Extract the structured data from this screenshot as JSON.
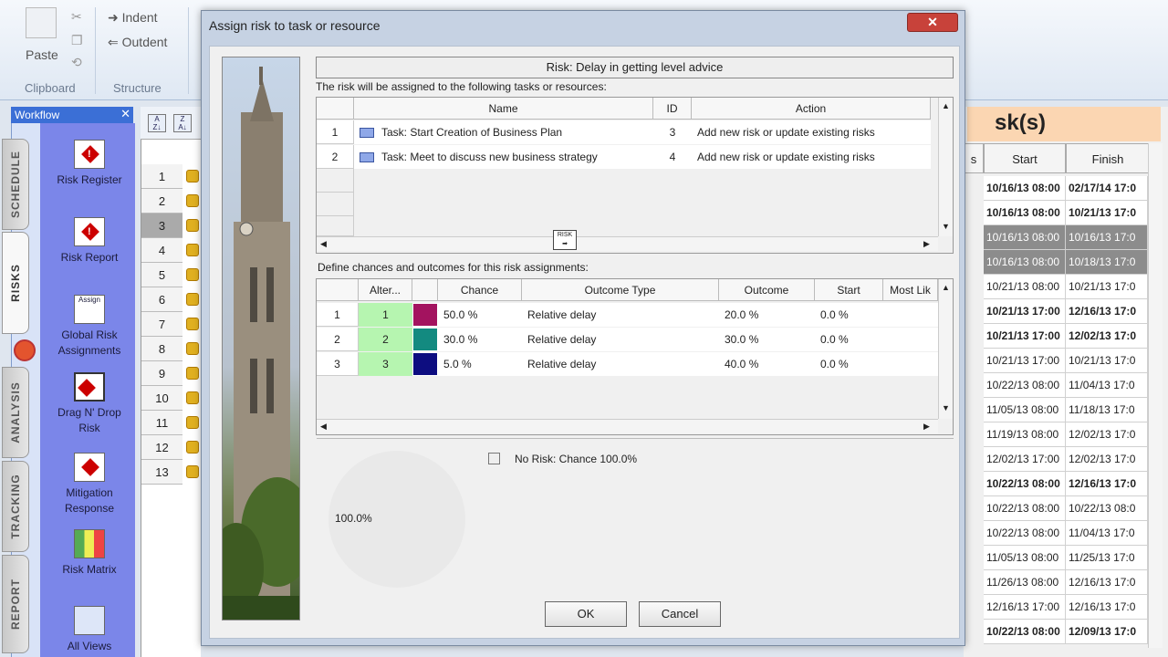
{
  "ribbon": {
    "paste_label": "Paste",
    "indent_label": "Indent",
    "outdent_label": "Outdent",
    "group_clipboard": "Clipboard",
    "group_structure": "Structure"
  },
  "workflow": {
    "title": "Workflow",
    "tabs": [
      "SCHEDULE",
      "RISKS",
      "ANALYSIS",
      "TRACKING",
      "REPORT"
    ],
    "items": [
      {
        "label": "Risk Register"
      },
      {
        "label": "Risk Report"
      },
      {
        "label": "Global Risk Assignments",
        "icon_text": "Assign"
      },
      {
        "label": "Drag N' Drop Risk"
      },
      {
        "label": "Mitigation Response"
      },
      {
        "label": "Risk Matrix"
      },
      {
        "label": "All Views"
      }
    ]
  },
  "left_grid": {
    "rows": [
      "1",
      "2",
      "3",
      "4",
      "5",
      "6",
      "7",
      "8",
      "9",
      "10",
      "11",
      "12",
      "13"
    ],
    "selected_row": "3"
  },
  "right_grid": {
    "title_fragment": "sk(s)",
    "header_fragment": "s",
    "headers": [
      "Start",
      "Finish"
    ],
    "rows": [
      {
        "start": "10/16/13 08:00",
        "finish": "02/17/14 17:0",
        "bold": true
      },
      {
        "start": "10/16/13 08:00",
        "finish": "10/21/13 17:0",
        "bold": true
      },
      {
        "start": "10/16/13 08:00",
        "finish": "10/16/13 17:0",
        "dark": true
      },
      {
        "start": "10/16/13 08:00",
        "finish": "10/18/13 17:0",
        "dark": true
      },
      {
        "start": "10/21/13 08:00",
        "finish": "10/21/13 17:0"
      },
      {
        "start": "10/21/13 17:00",
        "finish": "12/16/13 17:0",
        "bold": true
      },
      {
        "start": "10/21/13 17:00",
        "finish": "12/02/13 17:0",
        "bold": true
      },
      {
        "start": "10/21/13 17:00",
        "finish": "10/21/13 17:0"
      },
      {
        "start": "10/22/13 08:00",
        "finish": "11/04/13 17:0"
      },
      {
        "start": "11/05/13 08:00",
        "finish": "11/18/13 17:0"
      },
      {
        "start": "11/19/13 08:00",
        "finish": "12/02/13 17:0"
      },
      {
        "start": "12/02/13 17:00",
        "finish": "12/02/13 17:0"
      },
      {
        "start": "10/22/13 08:00",
        "finish": "12/16/13 17:0",
        "bold": true
      },
      {
        "start": "10/22/13 08:00",
        "finish": "10/22/13 08:0"
      },
      {
        "start": "10/22/13 08:00",
        "finish": "11/04/13 17:0"
      },
      {
        "start": "11/05/13 08:00",
        "finish": "11/25/13 17:0"
      },
      {
        "start": "11/26/13 08:00",
        "finish": "12/16/13 17:0"
      },
      {
        "start": "12/16/13 17:00",
        "finish": "12/16/13 17:0"
      },
      {
        "start": "10/22/13 08:00",
        "finish": "12/09/13 17:0",
        "bold": true
      }
    ]
  },
  "dialog": {
    "title": "Assign risk to task or resource",
    "close_label": "✕",
    "risk_title": "Risk: Delay in getting level advice",
    "assign_caption": "The risk will be assigned to the following tasks or resources:",
    "assign_table": {
      "headers": [
        "Name",
        "ID",
        "Action"
      ],
      "rows": [
        {
          "num": "1",
          "name": "Task: Start Creation of Business Plan",
          "id": "3",
          "action": "Add new risk or update existing risks"
        },
        {
          "num": "2",
          "name": "Task: Meet to discuss new business strategy",
          "id": "4",
          "action": "Add new risk or update existing risks"
        }
      ]
    },
    "drag_icon_text": "RISK",
    "outcomes_caption": "Define chances and outcomes for this risk assignments:",
    "outcomes_table": {
      "headers": [
        "Alter...",
        "Chance",
        "Outcome Type",
        "Outcome",
        "Start",
        "Most Lik"
      ],
      "rows": [
        {
          "num": "1",
          "alt": "1",
          "color": "#a3135f",
          "chance": "50.0 %",
          "type": "Relative delay",
          "outcome": "20.0 %",
          "start": "0.0 %"
        },
        {
          "num": "2",
          "alt": "2",
          "color": "#138a80",
          "chance": "30.0 %",
          "type": "Relative delay",
          "outcome": "30.0 %",
          "start": "0.0 %"
        },
        {
          "num": "3",
          "alt": "3",
          "color": "#0d0d80",
          "chance": "5.0 %",
          "type": "Relative delay",
          "outcome": "40.0 %",
          "start": "0.0 %"
        }
      ]
    },
    "chart": {
      "legend": "No Risk: Chance 100.0%",
      "pie_label": "100.0%"
    },
    "ok_label": "OK",
    "cancel_label": "Cancel"
  }
}
